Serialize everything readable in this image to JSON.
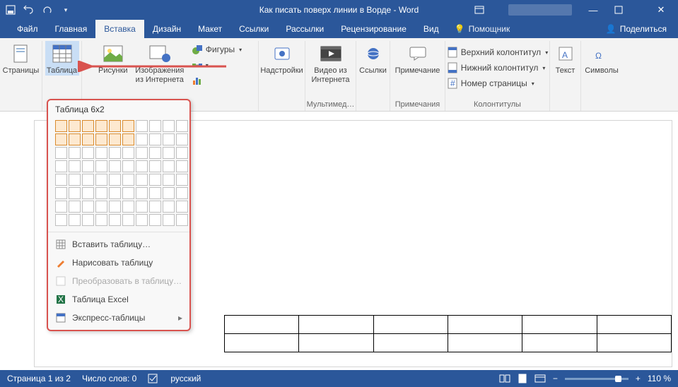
{
  "title": "Как писать поверх линии в Ворде  -  Word",
  "tabs": {
    "file": "Файл",
    "home": "Главная",
    "insert": "Вставка",
    "design": "Дизайн",
    "layout": "Макет",
    "references": "Ссылки",
    "mailings": "Рассылки",
    "review": "Рецензирование",
    "view": "Вид",
    "tell": "Помощник",
    "share": "Поделиться"
  },
  "ribbon": {
    "pages": {
      "btn": "Страницы",
      "label": ""
    },
    "tableBtn": "Таблица",
    "pictures": "Рисунки",
    "onlinePictures": "Изображения\nиз Интернета",
    "shapes": "Фигуры",
    "addins": "Надстройки",
    "video": "Видео из\nИнтернета",
    "media": "Мультимед…",
    "links": "Ссылки",
    "comment": "Примечание",
    "commentsGrp": "Примечания",
    "headerFooter": {
      "header": "Верхний колонтитул",
      "footer": "Нижний колонтитул",
      "page": "Номер страницы",
      "label": "Колонтитулы"
    },
    "text": "Текст",
    "symbols": "Символы"
  },
  "dropdown": {
    "header": "Таблица 6x2",
    "insert": "Вставить таблицу…",
    "draw": "Нарисовать таблицу",
    "convert": "Преобразовать в таблицу…",
    "excel": "Таблица Excel",
    "quick": "Экспресс-таблицы"
  },
  "status": {
    "page": "Страница 1 из 2",
    "words": "Число слов: 0",
    "lang": "русский",
    "zoom": "110 %"
  }
}
